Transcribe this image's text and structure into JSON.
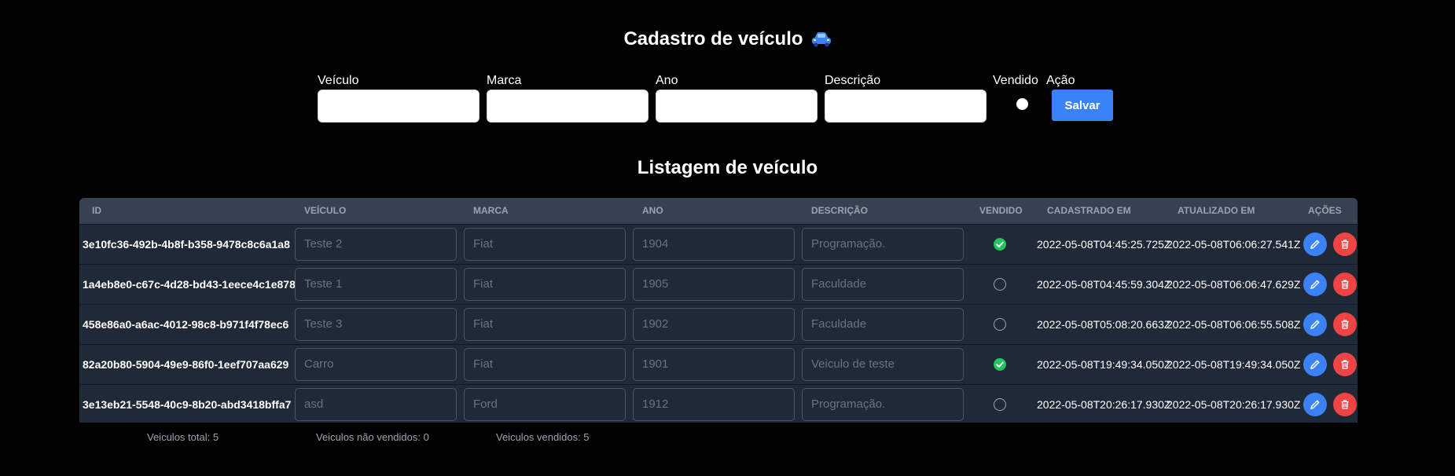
{
  "form": {
    "title": "Cadastro de veículo",
    "fields": [
      {
        "label": "Veículo",
        "value": ""
      },
      {
        "label": "Marca",
        "value": ""
      },
      {
        "label": "Ano",
        "value": ""
      },
      {
        "label": "Descrição",
        "value": ""
      }
    ],
    "sold_label": "Vendido",
    "action_label": "Ação",
    "save_label": "Salvar"
  },
  "list": {
    "title": "Listagem de veículo",
    "headers": [
      "ID",
      "VEÍCULO",
      "MARCA",
      "ANO",
      "DESCRIÇÃO",
      "VENDIDO",
      "CADASTRADO EM",
      "ATUALIZADO EM",
      "AÇÕES"
    ],
    "rows": [
      {
        "id": "3e10fc36-492b-4b8f-b358-9478c8c6a1a8",
        "veiculo": "Teste 2",
        "marca": "Fiat",
        "ano": "1904",
        "descricao": "Programação.",
        "vendido": true,
        "cadastrado": "2022-05-08T04:45:25.725Z",
        "atualizado": "2022-05-08T06:06:27.541Z"
      },
      {
        "id": "1a4eb8e0-c67c-4d28-bd43-1eece4c1e878",
        "veiculo": "Teste 1",
        "marca": "Fiat",
        "ano": "1905",
        "descricao": "Faculdade",
        "vendido": false,
        "cadastrado": "2022-05-08T04:45:59.304Z",
        "atualizado": "2022-05-08T06:06:47.629Z"
      },
      {
        "id": "458e86a0-a6ac-4012-98c8-b971f4f78ec6",
        "veiculo": "Teste 3",
        "marca": "Fiat",
        "ano": "1902",
        "descricao": "Faculdade",
        "vendido": false,
        "cadastrado": "2022-05-08T05:08:20.663Z",
        "atualizado": "2022-05-08T06:06:55.508Z"
      },
      {
        "id": "82a20b80-5904-49e9-86f0-1eef707aa629",
        "veiculo": "Carro",
        "marca": "Fiat",
        "ano": "1901",
        "descricao": "Veiculo de teste",
        "vendido": true,
        "cadastrado": "2022-05-08T19:49:34.050Z",
        "atualizado": "2022-05-08T19:49:34.050Z"
      },
      {
        "id": "3e13eb21-5548-40c9-8b20-abd3418bffa7",
        "veiculo": "asd",
        "marca": "Ford",
        "ano": "1912",
        "descricao": "Programação.",
        "vendido": false,
        "cadastrado": "2022-05-08T20:26:17.930Z",
        "atualizado": "2022-05-08T20:26:17.930Z"
      }
    ]
  },
  "footer": {
    "total": "Veiculos total: 5",
    "not_sold": "Veiculos não vendidos: 0",
    "sold": "Veiculos vendidos: 5"
  },
  "colors": {
    "accent": "#3b82f6",
    "danger": "#ef4444",
    "success": "#22c55e",
    "table_bg": "#1f2937",
    "header_bg": "#374151"
  },
  "icons": {
    "title": "car-icon",
    "edit": "pencil-icon",
    "delete": "trash-icon",
    "sold": "check-circle-icon"
  }
}
